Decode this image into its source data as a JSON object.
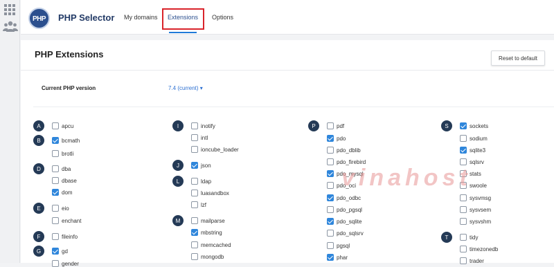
{
  "header": {
    "logo_text": "PHP",
    "app_title": "PHP Selector",
    "nav": [
      {
        "label": "My domains"
      },
      {
        "label": "Extensions"
      },
      {
        "label": "Options"
      }
    ]
  },
  "page": {
    "title": "PHP Extensions",
    "reset_label": "Reset to default",
    "version_label": "Current PHP version",
    "version_value": "7.4 (current) ▾"
  },
  "watermark": "vinahost",
  "colors": {
    "accent": "#2f86db",
    "highlight": "#d9232a",
    "letter_circle": "#243a56"
  },
  "columns": [
    {
      "letters": [
        "A",
        "B",
        "D",
        "E",
        "F",
        "G"
      ],
      "items": [
        {
          "label": "apcu",
          "checked": false
        },
        {
          "label": "bcmath",
          "checked": true
        },
        {
          "label": "brotli",
          "checked": false
        },
        {
          "label": "dba",
          "checked": false
        },
        {
          "label": "dbase",
          "checked": false
        },
        {
          "label": "dom",
          "checked": true
        },
        {
          "label": "eio",
          "checked": false
        },
        {
          "label": "enchant",
          "checked": false
        },
        {
          "label": "fileinfo",
          "checked": false
        },
        {
          "label": "gd",
          "checked": true
        },
        {
          "label": "gender",
          "checked": false
        }
      ]
    },
    {
      "letters": [
        "I",
        "J",
        "L",
        "M"
      ],
      "items": [
        {
          "label": "inotify",
          "checked": false
        },
        {
          "label": "intl",
          "checked": false
        },
        {
          "label": "ioncube_loader",
          "checked": false
        },
        {
          "label": "json",
          "checked": true
        },
        {
          "label": "ldap",
          "checked": false
        },
        {
          "label": "luasandbox",
          "checked": false
        },
        {
          "label": "lzf",
          "checked": false
        },
        {
          "label": "mailparse",
          "checked": false
        },
        {
          "label": "mbstring",
          "checked": true
        },
        {
          "label": "memcached",
          "checked": false
        },
        {
          "label": "mongodb",
          "checked": false
        }
      ]
    },
    {
      "letters": [
        "P"
      ],
      "items": [
        {
          "label": "pdf",
          "checked": false
        },
        {
          "label": "pdo",
          "checked": true
        },
        {
          "label": "pdo_dblib",
          "checked": false
        },
        {
          "label": "pdo_firebird",
          "checked": false
        },
        {
          "label": "pdo_mysql",
          "checked": true
        },
        {
          "label": "pdo_oci",
          "checked": false
        },
        {
          "label": "pdo_odbc",
          "checked": true
        },
        {
          "label": "pdo_pgsql",
          "checked": false
        },
        {
          "label": "pdo_sqlite",
          "checked": true
        },
        {
          "label": "pdo_sqlsrv",
          "checked": false
        },
        {
          "label": "pgsql",
          "checked": false
        },
        {
          "label": "phar",
          "checked": true
        }
      ]
    },
    {
      "letters": [
        "S",
        "T"
      ],
      "items": [
        {
          "label": "sockets",
          "checked": true
        },
        {
          "label": "sodium",
          "checked": false
        },
        {
          "label": "sqlite3",
          "checked": true
        },
        {
          "label": "sqlsrv",
          "checked": false
        },
        {
          "label": "stats",
          "checked": false
        },
        {
          "label": "swoole",
          "checked": false
        },
        {
          "label": "sysvmsg",
          "checked": false
        },
        {
          "label": "sysvsem",
          "checked": false
        },
        {
          "label": "sysvshm",
          "checked": false
        },
        {
          "label": "tidy",
          "checked": false
        },
        {
          "label": "timezonedb",
          "checked": false
        },
        {
          "label": "trader",
          "checked": false
        }
      ]
    }
  ]
}
